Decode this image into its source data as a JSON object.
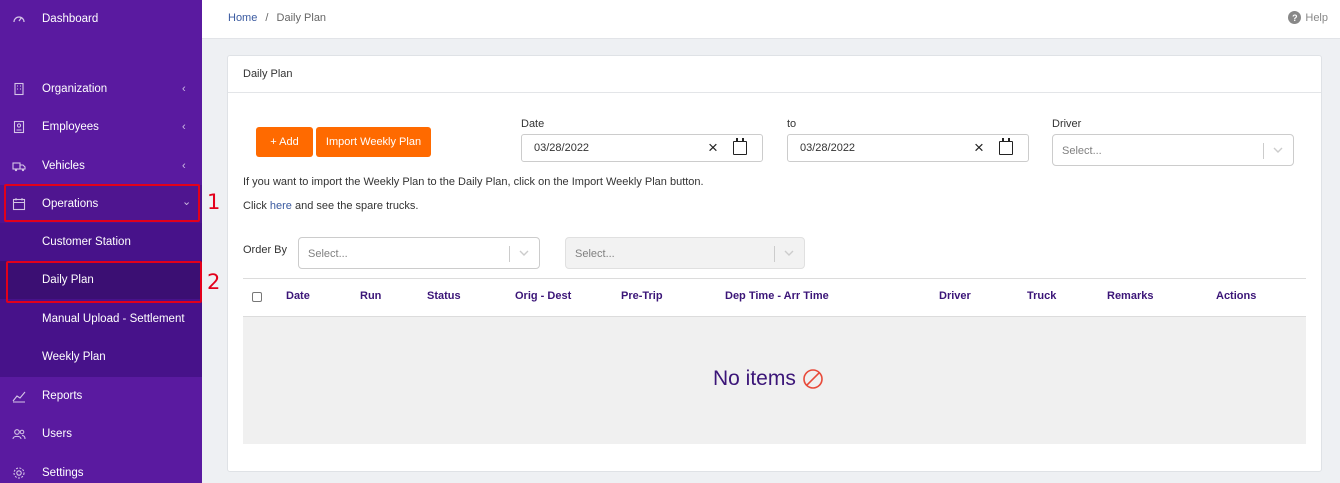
{
  "sidebar": {
    "items": [
      {
        "label": "Dashboard",
        "icon": "gauge-icon"
      },
      {
        "label": "Organization",
        "icon": "building-icon",
        "chevron": "‹"
      },
      {
        "label": "Employees",
        "icon": "id-badge-icon",
        "chevron": "‹"
      },
      {
        "label": "Vehicles",
        "icon": "truck-icon",
        "chevron": "‹"
      },
      {
        "label": "Operations",
        "icon": "calendar-icon",
        "chevron": "⌄"
      },
      {
        "label": "Reports",
        "icon": "chart-line-icon"
      },
      {
        "label": "Users",
        "icon": "users-icon"
      },
      {
        "label": "Settings",
        "icon": "gear-icon"
      }
    ],
    "submenu": [
      {
        "label": "Customer Station"
      },
      {
        "label": "Daily Plan"
      },
      {
        "label": "Manual Upload - Settlement"
      },
      {
        "label": "Weekly Plan"
      }
    ],
    "colors": {
      "bg": "#5a1aa0",
      "submenu_bg": "#47128a",
      "active_bg": "#3b0f73"
    }
  },
  "annotations": {
    "one": "1",
    "two": "2",
    "color": "#e3001b"
  },
  "topbar": {
    "breadcrumb_home": "Home",
    "breadcrumb_sep": "/",
    "breadcrumb_current": "Daily Plan",
    "help": "Help"
  },
  "card": {
    "title": "Daily Plan",
    "add_button": "+ Add",
    "import_button": "Import Weekly Plan",
    "date_label": "Date",
    "date_value": "03/28/2022",
    "to_label": "to",
    "to_value": "03/28/2022",
    "driver_label": "Driver",
    "driver_placeholder": "Select...",
    "info_line": "If you want to import the Weekly Plan to the Daily Plan, click on the Import Weekly Plan button.",
    "click_prefix": "Click ",
    "click_link": "here",
    "click_suffix": " and see the spare trucks.",
    "order_by_label": "Order By",
    "order_by_placeholder": "Select...",
    "order_dir_placeholder": "Select...",
    "accent": "#ff6a00"
  },
  "table": {
    "columns": [
      "Date",
      "Run",
      "Status",
      "Orig - Dest",
      "Pre-Trip",
      "Dep Time - Arr Time",
      "Driver",
      "Truck",
      "Remarks",
      "Actions"
    ],
    "empty_text": "No items"
  }
}
